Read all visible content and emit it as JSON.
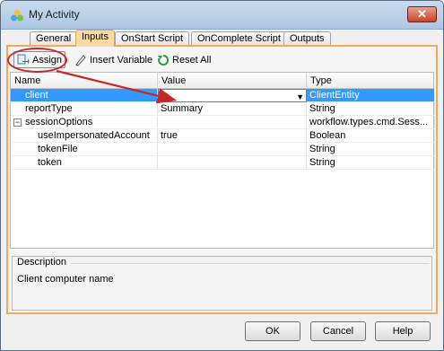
{
  "window": {
    "title": "My Activity",
    "close_label": "✕"
  },
  "tabs": [
    "General",
    "Inputs",
    "OnStart Script",
    "OnComplete Script",
    "Outputs"
  ],
  "toolbar": {
    "assign_label": "Assign",
    "insert_variable_label": "Insert Variable",
    "reset_all_label": "Reset All"
  },
  "grid": {
    "headers": [
      "Name",
      "Value",
      "Type"
    ],
    "rows": [
      {
        "name": "client",
        "value": "",
        "type": "ClientEntity",
        "selected": true
      },
      {
        "name": "reportType",
        "value": "Summary",
        "type": "String"
      },
      {
        "name": "sessionOptions",
        "value": "",
        "type": "workflow.types.cmd.Sess...",
        "expander": "−"
      },
      {
        "name": "useImpersonatedAccount",
        "value": "true",
        "type": "Boolean"
      },
      {
        "name": "tokenFile",
        "value": "",
        "type": "String"
      },
      {
        "name": "token",
        "value": "",
        "type": "String"
      }
    ]
  },
  "description": {
    "title": "Description",
    "text": "Client computer name"
  },
  "buttons": {
    "ok": "OK",
    "cancel": "Cancel",
    "help": "Help"
  },
  "colors": {
    "accent": "#f2a957",
    "selection": "#3399ff",
    "annotation": "#c62828"
  },
  "icons": {
    "assign": "assign-icon",
    "insert": "insert-variable-icon",
    "reset": "reset-icon"
  }
}
